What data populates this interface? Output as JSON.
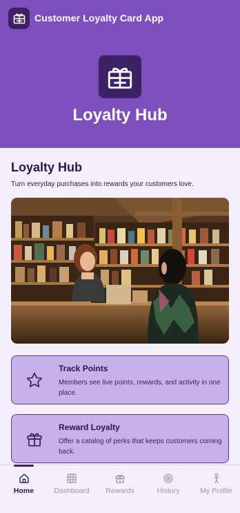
{
  "app": {
    "title": "Customer Loyalty Card App",
    "icon": "gift-card-icon"
  },
  "hero": {
    "title": "Loyalty Hub",
    "icon": "gift-card-icon"
  },
  "section": {
    "title": "Loyalty Hub",
    "subtitle": "Turn everyday purchases into rewards your customers love."
  },
  "features": [
    {
      "title": "Track Points",
      "description": "Members see live points, rewards, and activity in one place.",
      "icon": "star-icon"
    },
    {
      "title": "Reward Loyalty",
      "description": "Offer a catalog of perks that keeps customers coming back.",
      "icon": "gift-icon"
    }
  ],
  "tabs": [
    {
      "label": "Home",
      "icon": "home-icon",
      "active": true
    },
    {
      "label": "Dashboard",
      "icon": "dashboard-grid-icon",
      "active": false
    },
    {
      "label": "Rewards",
      "icon": "gift-icon",
      "active": false
    },
    {
      "label": "History",
      "icon": "target-icon",
      "active": false
    },
    {
      "label": "My Profile",
      "icon": "person-icon",
      "active": false
    }
  ],
  "colors": {
    "primary": "#7c4fbc",
    "dark": "#3d2165",
    "card": "#c8b0eb",
    "background": "#f4effb",
    "text": "#2a1646"
  }
}
